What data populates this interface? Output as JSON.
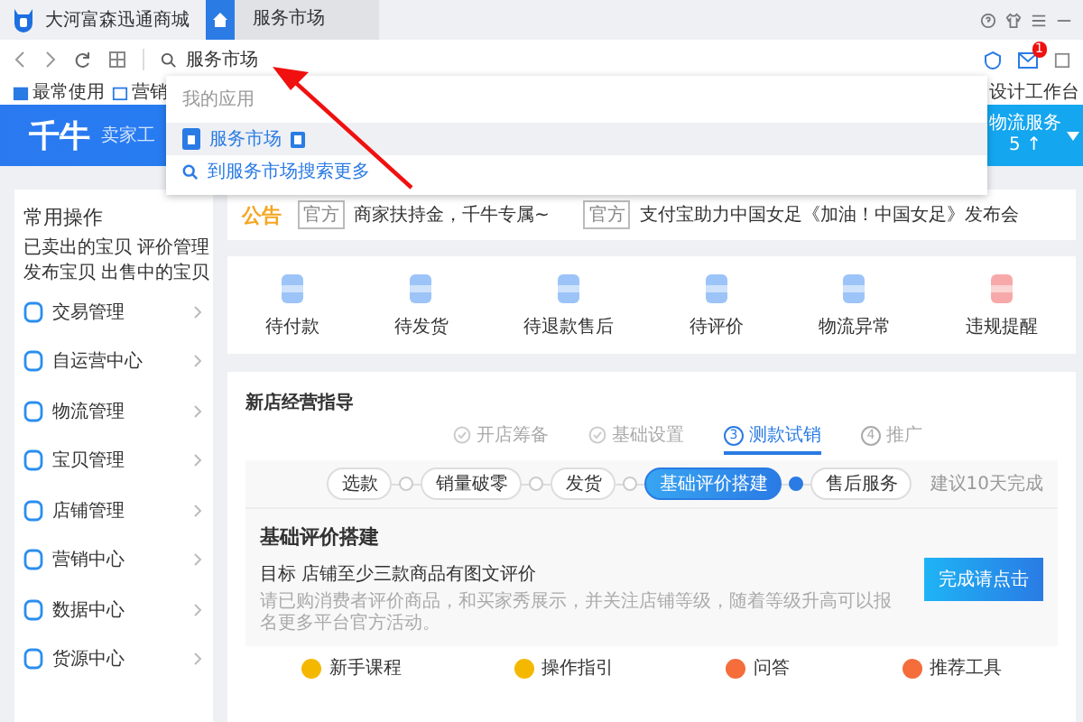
{
  "window": {
    "title": "大河富森迅通商城"
  },
  "tabs": [
    {
      "kind": "home",
      "selected": true
    },
    {
      "kind": "page",
      "label": "服务市场",
      "selected": false
    }
  ],
  "address_bar": {
    "value": "服务市场",
    "mail_badge": "1"
  },
  "bookmarks": [
    {
      "label": "最常使用"
    },
    {
      "label": "营销"
    }
  ],
  "bookmarks_right": "设计工作台",
  "search_dropdown": {
    "section": "我的应用",
    "items": [
      {
        "kind": "app",
        "label": "服务市场",
        "selected": true
      },
      {
        "kind": "search",
        "label": "到服务市场搜索更多",
        "selected": false
      }
    ]
  },
  "header": {
    "logo": "千牛",
    "subtitle": "卖家工",
    "service": {
      "label": "物流服务",
      "value": "5 ↑"
    }
  },
  "sidebar": {
    "title": "常用操作",
    "links": [
      [
        "已卖出的宝贝",
        "评价管理"
      ],
      [
        "发布宝贝",
        "出售中的宝贝"
      ]
    ],
    "items": [
      {
        "label": "交易管理"
      },
      {
        "label": "自运营中心"
      },
      {
        "label": "物流管理"
      },
      {
        "label": "宝贝管理"
      },
      {
        "label": "店铺管理"
      },
      {
        "label": "营销中心"
      },
      {
        "label": "数据中心"
      },
      {
        "label": "货源中心"
      }
    ]
  },
  "notice": {
    "title": "公告",
    "items": [
      {
        "tag": "官方",
        "text": "商家扶持金，千牛专属~"
      },
      {
        "tag": "官方",
        "text": "支付宝助力中国女足《加油！中国女足》发布会"
      }
    ]
  },
  "orders": [
    {
      "label": "待付款",
      "color": "#9cc4f8"
    },
    {
      "label": "待发货",
      "color": "#9cc4f8"
    },
    {
      "label": "待退款售后",
      "color": "#9cc4f8"
    },
    {
      "label": "待评价",
      "color": "#9cc4f8"
    },
    {
      "label": "物流异常",
      "color": "#9cc4f8"
    },
    {
      "label": "违规提醒",
      "color": "#f7a9a9"
    }
  ],
  "guide": {
    "title": "新店经营指导",
    "stages": [
      {
        "kind": "done",
        "label": "开店筹备",
        "selected": false
      },
      {
        "kind": "done",
        "label": "基础设置",
        "selected": false
      },
      {
        "kind": "numbered",
        "number": "3",
        "label": "测款试销",
        "selected": true
      },
      {
        "kind": "numbered",
        "number": "4",
        "label": "推广",
        "selected": false
      }
    ],
    "steps": [
      {
        "label": "选款",
        "selected": false
      },
      {
        "label": "销量破零",
        "selected": false
      },
      {
        "label": "发货",
        "selected": false
      },
      {
        "label": "基础评价搭建",
        "selected": true
      },
      {
        "label": "售后服务",
        "selected": false
      }
    ],
    "suggestion": "建议10天完成",
    "task": {
      "title": "基础评价搭建",
      "goal": "目标 店铺至少三款商品有图文评价",
      "description": "请已购消费者评价商品，和买家秀展示，并关注店铺等级，随着等级升高可以报名更多平台官方活动。",
      "button": "完成请点击"
    },
    "resources": [
      {
        "label": "新手课程",
        "color": "#f5b800"
      },
      {
        "label": "操作指引",
        "color": "#f5b800"
      },
      {
        "label": "问答",
        "color": "#f46d3b"
      },
      {
        "label": "推荐工具",
        "color": "#f46d3b"
      }
    ]
  }
}
